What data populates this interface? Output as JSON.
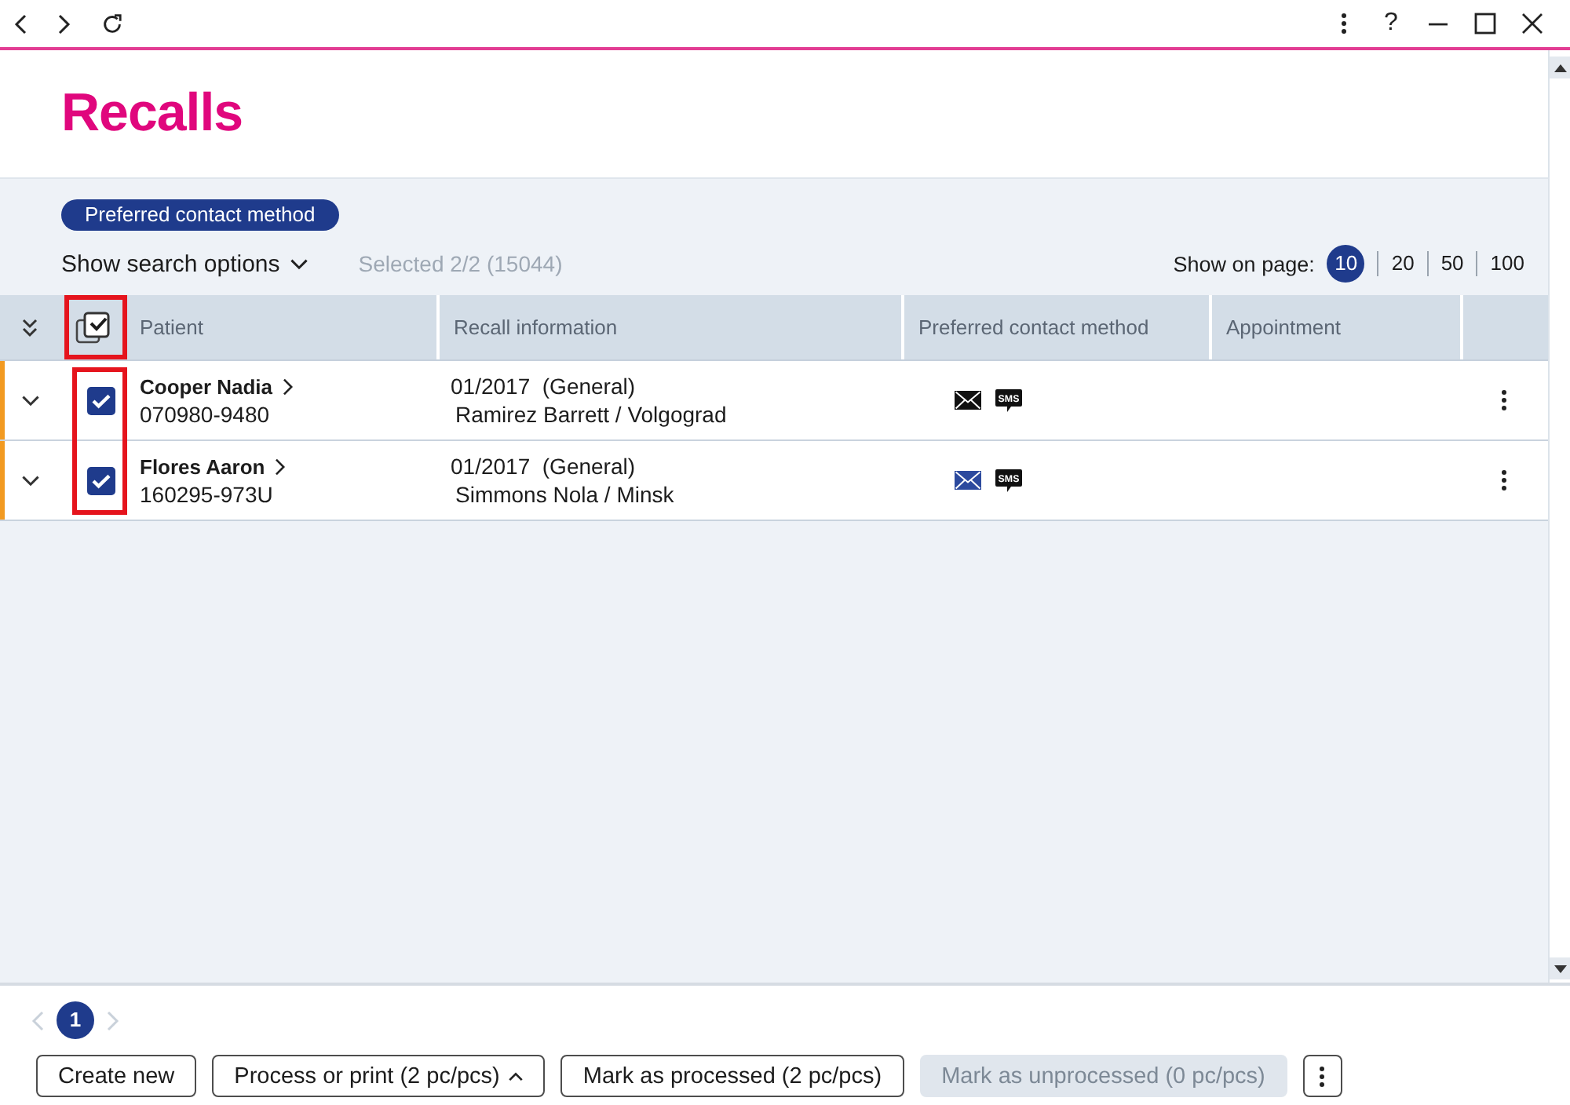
{
  "window": {
    "help": "?"
  },
  "page": {
    "title": "Recalls"
  },
  "filters": [
    {
      "label": "Preferred contact method"
    }
  ],
  "search_options": {
    "label": "Show search options",
    "expanded": false
  },
  "selection_summary": "Selected 2/2 (15044)",
  "page_size": {
    "label": "Show on page:",
    "options": [
      {
        "label": "10",
        "selected": true
      },
      {
        "label": "20",
        "selected": false
      },
      {
        "label": "50",
        "selected": false
      },
      {
        "label": "100",
        "selected": false
      }
    ]
  },
  "table": {
    "select_all": {
      "checked": true,
      "highlighted": true
    },
    "row_checkboxes_highlighted": true,
    "columns": [
      {
        "label": "Patient"
      },
      {
        "label": "Recall information"
      },
      {
        "label": "Preferred contact method"
      },
      {
        "label": "Appointment"
      }
    ],
    "rows": [
      {
        "expanded": false,
        "flagged": true,
        "selected": true,
        "name": "Cooper Nadia",
        "patient_id": "070980-9480",
        "recall": "01/2017  (General)",
        "recall_detail": "Ramirez Barrett / Volgograd",
        "contact_methods": [
          {
            "kind": "email",
            "color": "#111111"
          },
          {
            "kind": "sms",
            "label": "SMS"
          }
        ]
      },
      {
        "expanded": false,
        "flagged": true,
        "selected": true,
        "name": "Flores Aaron",
        "patient_id": "160295-973U",
        "recall": "01/2017  (General)",
        "recall_detail": "Simmons Nola / Minsk",
        "contact_methods": [
          {
            "kind": "email",
            "color": "#2c4a9e"
          },
          {
            "kind": "sms",
            "label": "SMS"
          }
        ]
      }
    ]
  },
  "pagination": {
    "previous_disabled": true,
    "next_disabled": true,
    "pages": [
      {
        "label": "1",
        "selected": true
      }
    ]
  },
  "actions": [
    {
      "kind": "button",
      "label": "Create new",
      "disabled": false
    },
    {
      "kind": "menu-button",
      "label": "Process or print (2 pc/pcs)",
      "disabled": false
    },
    {
      "kind": "button",
      "label": "Mark as processed (2 pc/pcs)",
      "disabled": false
    },
    {
      "kind": "button",
      "label": "Mark as unprocessed (0 pc/pcs)",
      "disabled": true
    },
    {
      "kind": "more"
    }
  ]
}
